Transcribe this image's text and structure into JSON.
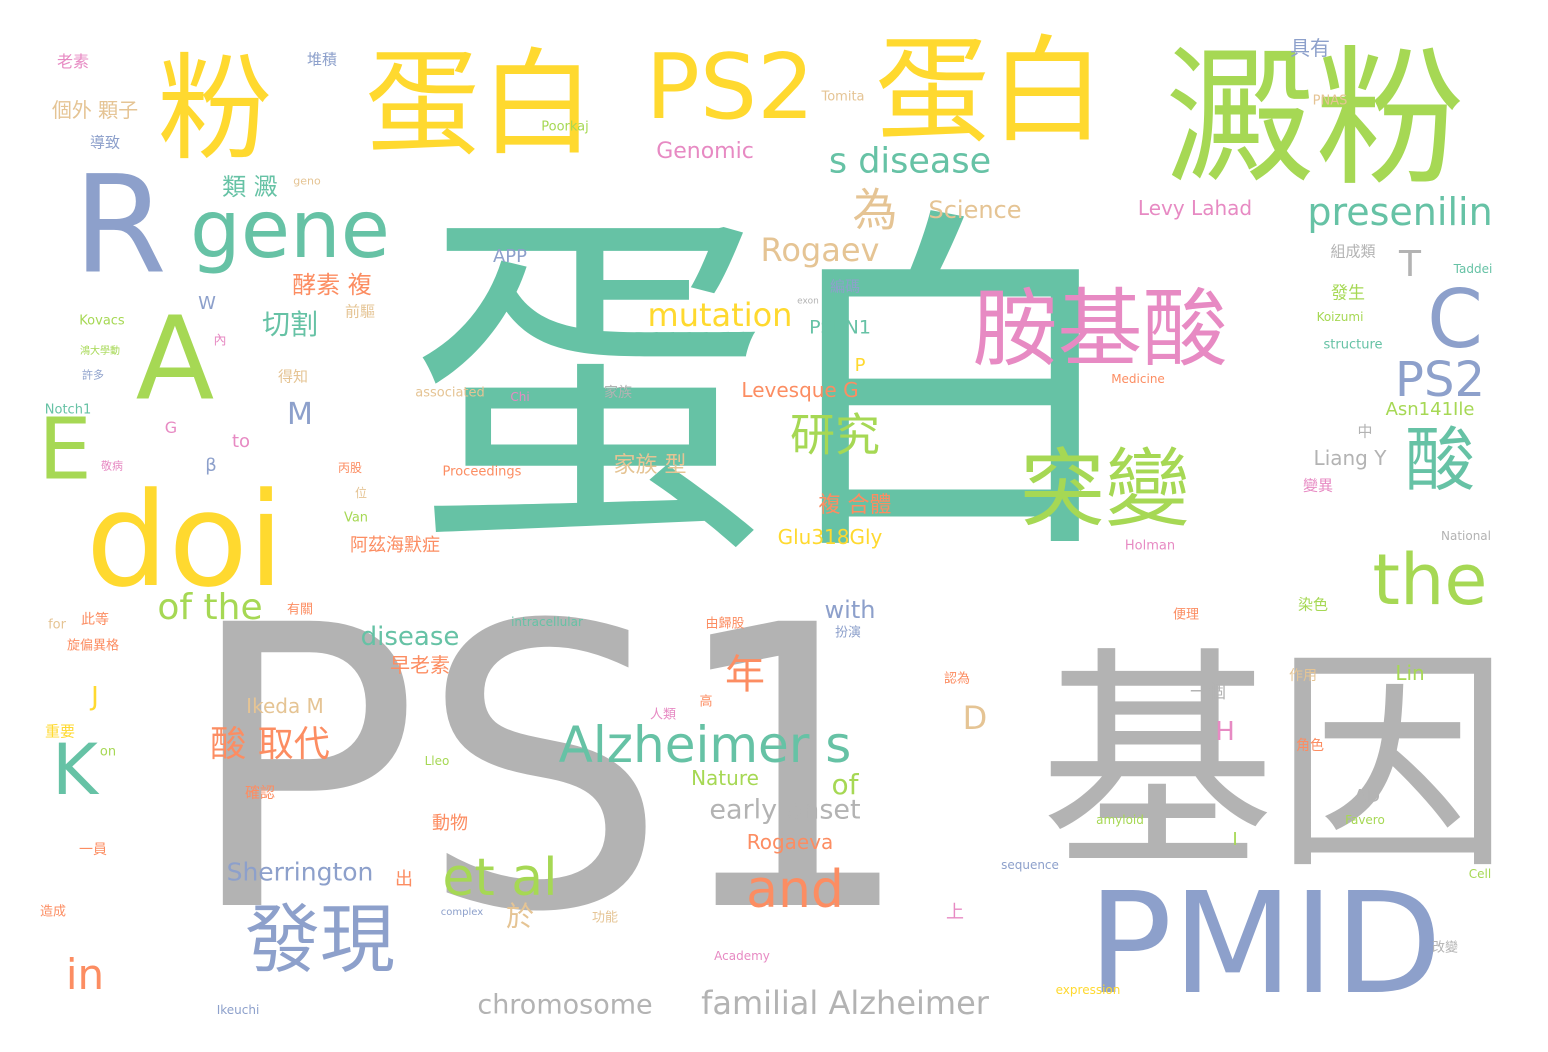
{
  "palette": {
    "teal": "#66c2a5",
    "gray": "#b3b3b3",
    "blue": "#8da0cb",
    "yellow": "#ffd92f",
    "green": "#a6d854",
    "pink": "#e78ac3",
    "orange": "#fc8d62",
    "tan": "#e5c494"
  },
  "words": [
    {
      "text": "蛋白",
      "color": "teal"
    },
    {
      "text": "PS1",
      "color": "gray"
    },
    {
      "text": "基因",
      "color": "gray"
    },
    {
      "text": "澱粉",
      "color": "green"
    },
    {
      "text": "粉",
      "color": "yellow"
    },
    {
      "text": "蛋白",
      "color": "yellow"
    },
    {
      "text": "PS2",
      "color": "yellow"
    },
    {
      "text": "蛋白",
      "color": "yellow"
    },
    {
      "text": "PMID",
      "color": "blue"
    },
    {
      "text": "R",
      "color": "blue"
    },
    {
      "text": "A",
      "color": "green"
    },
    {
      "text": "gene",
      "color": "teal"
    },
    {
      "text": "doi",
      "color": "yellow"
    },
    {
      "text": "E",
      "color": "green"
    },
    {
      "text": "胺基酸",
      "color": "pink"
    },
    {
      "text": "突變",
      "color": "green"
    },
    {
      "text": "C",
      "color": "blue"
    },
    {
      "text": "PS2",
      "color": "blue"
    },
    {
      "text": "酸",
      "color": "teal"
    },
    {
      "text": "the",
      "color": "green"
    },
    {
      "text": "發現",
      "color": "blue"
    },
    {
      "text": "Alzheimer s",
      "color": "teal"
    },
    {
      "text": "et al",
      "color": "green"
    },
    {
      "text": "and",
      "color": "orange"
    },
    {
      "text": "K",
      "color": "teal"
    },
    {
      "text": "in",
      "color": "orange"
    },
    {
      "text": "of the",
      "color": "green"
    },
    {
      "text": "研究",
      "color": "green"
    },
    {
      "text": "s disease",
      "color": "teal"
    },
    {
      "text": "presenilin",
      "color": "teal"
    },
    {
      "text": "為",
      "color": "tan"
    },
    {
      "text": "Rogaev",
      "color": "tan"
    },
    {
      "text": "mutation",
      "color": "yellow"
    },
    {
      "text": "酸 取代",
      "color": "orange"
    },
    {
      "text": "年",
      "color": "orange"
    },
    {
      "text": "familial Alzheimer",
      "color": "gray"
    },
    {
      "text": "early onset",
      "color": "gray"
    },
    {
      "text": "chromosome",
      "color": "gray"
    },
    {
      "text": "Sherrington",
      "color": "blue"
    },
    {
      "text": "disease",
      "color": "teal"
    },
    {
      "text": "of",
      "color": "green"
    },
    {
      "text": "with",
      "color": "blue"
    },
    {
      "text": "於",
      "color": "tan"
    },
    {
      "text": "切割",
      "color": "teal"
    },
    {
      "text": "酵素 複",
      "color": "orange"
    },
    {
      "text": "類 澱",
      "color": "teal"
    },
    {
      "text": "Genomic",
      "color": "pink"
    },
    {
      "text": "Science",
      "color": "tan"
    },
    {
      "text": "Levy Lahad",
      "color": "pink"
    },
    {
      "text": "Glu318Gly",
      "color": "yellow"
    },
    {
      "text": "Asn141Ile",
      "color": "green"
    },
    {
      "text": "Liang Y",
      "color": "gray"
    },
    {
      "text": "Levesque G",
      "color": "orange"
    },
    {
      "text": "Ikeda M",
      "color": "tan"
    },
    {
      "text": "Rogaeva",
      "color": "orange"
    },
    {
      "text": "Nature",
      "color": "green"
    },
    {
      "text": "PSEN1",
      "color": "teal"
    },
    {
      "text": "APP",
      "color": "blue"
    },
    {
      "text": "家族 型",
      "color": "tan"
    },
    {
      "text": "複 合體",
      "color": "orange"
    },
    {
      "text": "阿茲海默症",
      "color": "orange"
    },
    {
      "text": "早老素",
      "color": "orange"
    },
    {
      "text": "個外 顆子",
      "color": "tan"
    },
    {
      "text": "具有",
      "color": "blue"
    },
    {
      "text": "T",
      "color": "gray"
    },
    {
      "text": "M",
      "color": "blue"
    },
    {
      "text": "D",
      "color": "tan"
    },
    {
      "text": "J",
      "color": "yellow"
    },
    {
      "text": "H",
      "color": "pink"
    },
    {
      "text": "Tomita",
      "color": "tan"
    },
    {
      "text": "Poorkaj",
      "color": "green"
    },
    {
      "text": "PNAS",
      "color": "tan"
    },
    {
      "text": "Kovacs",
      "color": "green"
    },
    {
      "text": "Notch1",
      "color": "teal"
    },
    {
      "text": "associated",
      "color": "tan"
    },
    {
      "text": "Proceedings",
      "color": "orange"
    },
    {
      "text": "Medicine",
      "color": "orange"
    },
    {
      "text": "structure",
      "color": "teal"
    },
    {
      "text": "Koizumi",
      "color": "green"
    },
    {
      "text": "Taddei",
      "color": "teal"
    },
    {
      "text": "Holman",
      "color": "pink"
    },
    {
      "text": "National",
      "color": "gray"
    },
    {
      "text": "intracellular",
      "color": "teal"
    },
    {
      "text": "amyloid",
      "color": "green"
    },
    {
      "text": "Favero",
      "color": "green"
    },
    {
      "text": "sequence",
      "color": "blue"
    },
    {
      "text": "expression",
      "color": "yellow"
    },
    {
      "text": "complex",
      "color": "blue"
    },
    {
      "text": "Ikeuchi",
      "color": "blue"
    },
    {
      "text": "Academy",
      "color": "pink"
    },
    {
      "text": "Cell",
      "color": "green"
    },
    {
      "text": "Lin",
      "color": "green"
    },
    {
      "text": "AD",
      "color": "gray"
    },
    {
      "text": "Lleo",
      "color": "green"
    },
    {
      "text": "Van",
      "color": "green"
    },
    {
      "text": "Chi",
      "color": "pink"
    },
    {
      "text": "to",
      "color": "pink"
    },
    {
      "text": "for",
      "color": "tan"
    },
    {
      "text": "W",
      "color": "blue"
    },
    {
      "text": "G",
      "color": "pink"
    },
    {
      "text": "β",
      "color": "blue"
    },
    {
      "text": "on",
      "color": "green"
    },
    {
      "text": "P",
      "color": "yellow"
    },
    {
      "text": "I",
      "color": "green"
    },
    {
      "text": "老素",
      "color": "pink"
    },
    {
      "text": "堆積",
      "color": "blue"
    },
    {
      "text": "導致",
      "color": "blue"
    },
    {
      "text": "前驅",
      "color": "tan"
    },
    {
      "text": "得知",
      "color": "tan"
    },
    {
      "text": "家族",
      "color": "gray"
    },
    {
      "text": "編碼",
      "color": "blue"
    },
    {
      "text": "發生",
      "color": "green"
    },
    {
      "text": "組成類",
      "color": "gray"
    },
    {
      "text": "變異",
      "color": "pink"
    },
    {
      "text": "中",
      "color": "gray"
    },
    {
      "text": "染色",
      "color": "green"
    },
    {
      "text": "作用",
      "color": "tan"
    },
    {
      "text": "角色",
      "color": "orange"
    },
    {
      "text": "改變",
      "color": "gray"
    },
    {
      "text": "一個",
      "color": "gray"
    },
    {
      "text": "動物",
      "color": "orange"
    },
    {
      "text": "上",
      "color": "pink"
    },
    {
      "text": "出",
      "color": "orange"
    },
    {
      "text": "確認",
      "color": "orange"
    },
    {
      "text": "重要",
      "color": "yellow"
    },
    {
      "text": "此等",
      "color": "orange"
    },
    {
      "text": "旋偏異格",
      "color": "orange"
    },
    {
      "text": "一員",
      "color": "orange"
    },
    {
      "text": "造成",
      "color": "orange"
    },
    {
      "text": "有關",
      "color": "orange"
    },
    {
      "text": "功能",
      "color": "tan"
    },
    {
      "text": "由歸股",
      "color": "orange"
    },
    {
      "text": "扮演",
      "color": "blue"
    },
    {
      "text": "便理",
      "color": "orange"
    },
    {
      "text": "認為",
      "color": "orange"
    },
    {
      "text": "人類",
      "color": "pink"
    },
    {
      "text": "高",
      "color": "orange"
    },
    {
      "text": "位",
      "color": "tan"
    },
    {
      "text": "丙股",
      "color": "orange"
    },
    {
      "text": "鴻大學動",
      "color": "green"
    },
    {
      "text": "許多",
      "color": "blue"
    },
    {
      "text": "敬病",
      "color": "pink"
    },
    {
      "text": "內",
      "color": "pink"
    },
    {
      "text": "geno",
      "color": "tan"
    },
    {
      "text": "exon",
      "color": "gray"
    }
  ]
}
